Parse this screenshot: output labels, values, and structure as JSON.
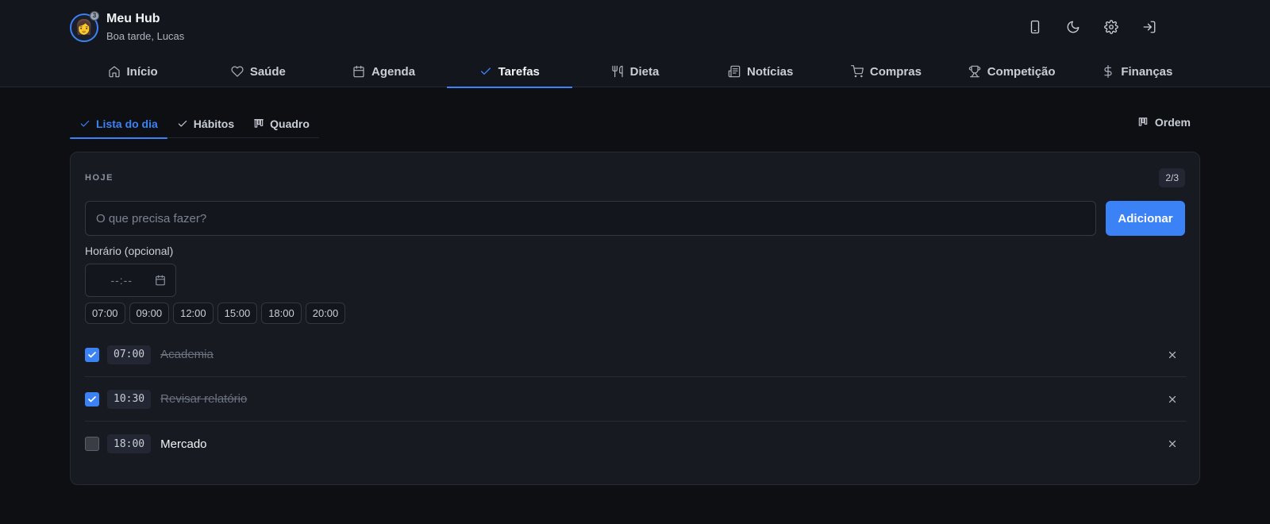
{
  "app": {
    "title": "Meu Hub",
    "greeting": "Boa tarde, Lucas",
    "avatar_icon": "medal-avatar-icon",
    "medal_label": "3"
  },
  "header_icons": [
    "phone-icon",
    "moon-icon",
    "gear-icon",
    "logout-icon"
  ],
  "nav": {
    "items": [
      {
        "label": "Início",
        "icon": "home-icon"
      },
      {
        "label": "Saúde",
        "icon": "heart-icon"
      },
      {
        "label": "Agenda",
        "icon": "calendar-icon"
      },
      {
        "label": "Tarefas",
        "icon": "check-icon",
        "active": true
      },
      {
        "label": "Dieta",
        "icon": "utensils-icon"
      },
      {
        "label": "Notícias",
        "icon": "newspaper-icon"
      },
      {
        "label": "Compras",
        "icon": "cart-icon"
      },
      {
        "label": "Competição",
        "icon": "trophy-icon"
      },
      {
        "label": "Finanças",
        "icon": "dollar-icon"
      }
    ]
  },
  "subtabs": {
    "items": [
      {
        "label": "Lista do dia",
        "icon": "check-icon",
        "active": true
      },
      {
        "label": "Hábitos",
        "icon": "check-icon"
      },
      {
        "label": "Quadro",
        "icon": "kanban-icon"
      }
    ],
    "order_label": "Ordem"
  },
  "today": {
    "section_label": "HOJE",
    "count": "2/3",
    "input_placeholder": "O que precisa fazer?",
    "add_label": "Adicionar",
    "time_label": "Horário (opcional)",
    "time_placeholder": "--:--",
    "time_chips": [
      "07:00",
      "09:00",
      "12:00",
      "15:00",
      "18:00",
      "20:00"
    ],
    "tasks": [
      {
        "time": "07:00",
        "title": "Academia",
        "done": true
      },
      {
        "time": "10:30",
        "title": "Revisar relatório",
        "done": true
      },
      {
        "time": "18:00",
        "title": "Mercado",
        "done": false
      }
    ]
  },
  "colors": {
    "accent": "#3b82f6",
    "background": "#0d0f13",
    "card": "#171a21"
  }
}
